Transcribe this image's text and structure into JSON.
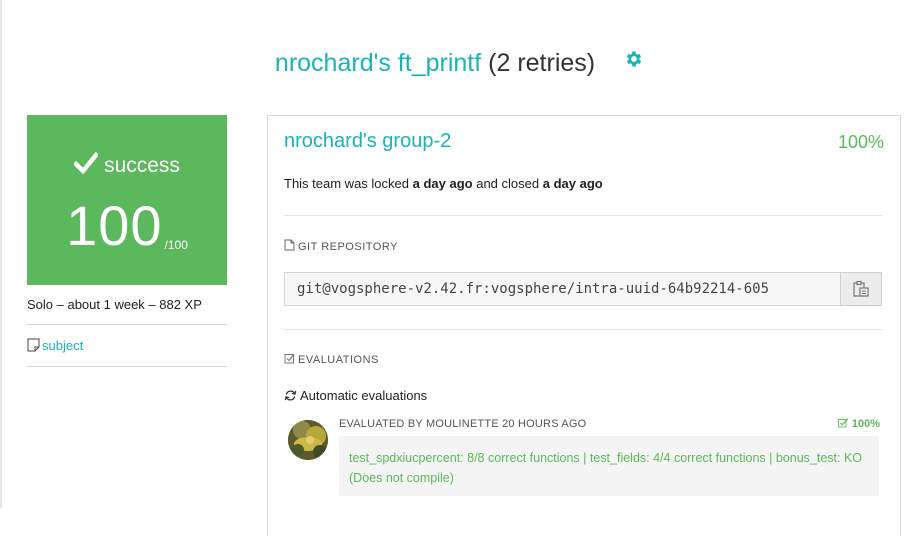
{
  "header": {
    "title_accent": "nrochard's ft_printf",
    "title_rest": "(2 retries)",
    "settings_icon": "gear-icon"
  },
  "score_card": {
    "status": "success",
    "score": "100",
    "max": "/100",
    "status_icon": "checkmark-icon"
  },
  "project_meta": "Solo – about 1 week – 882 XP",
  "subject_link": "subject",
  "team": {
    "name": "nrochard's group-2",
    "percent": "100%",
    "locked_prefix": "This team was locked",
    "locked_time": "a day ago",
    "closed_prefix": "and closed",
    "closed_time": "a day ago"
  },
  "git": {
    "label": "GIT REPOSITORY",
    "url": "git@vogsphere-v2.42.fr:vogsphere/intra-uuid-64b92214-605"
  },
  "evaluations": {
    "label": "EVALUATIONS",
    "automatic_label": "Automatic evaluations",
    "evaluator": "EVALUATED BY MOULINETTE 20 HOURS AGO",
    "percent": "100%",
    "feedback": "test_spdxiucpercent: 8/8 correct functions | test_fields: 4/4 correct functions | bonus_test: KO (Does not compile)"
  },
  "colors": {
    "accent": "#1ab3b8",
    "success": "#5cb85c"
  }
}
